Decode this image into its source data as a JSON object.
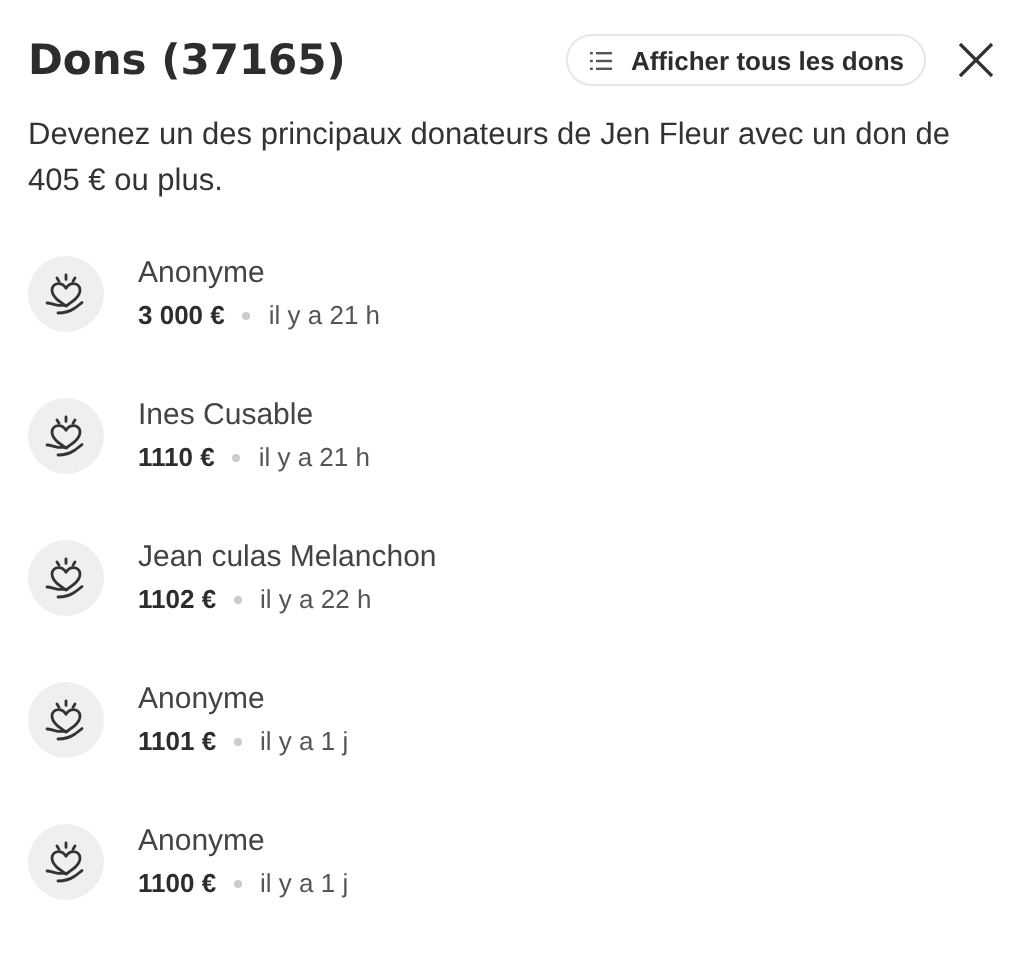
{
  "header": {
    "title": "Dons (37165)",
    "show_all_button": "Afficher tous les dons"
  },
  "description": "Devenez un des principaux donateurs de Jen Fleur avec un don de 405 € ou plus.",
  "donations": [
    {
      "name": "Anonyme",
      "amount": "3 000 €",
      "time": "il y a 21 h"
    },
    {
      "name": "Ines Cusable",
      "amount": "1110 €",
      "time": "il y a 21 h"
    },
    {
      "name": "Jean culas Melanchon",
      "amount": "1102 €",
      "time": "il y a 22 h"
    },
    {
      "name": "Anonyme",
      "amount": "1101 €",
      "time": "il y a 1 j"
    },
    {
      "name": "Anonyme",
      "amount": "1100 €",
      "time": "il y a 1 j"
    }
  ]
}
